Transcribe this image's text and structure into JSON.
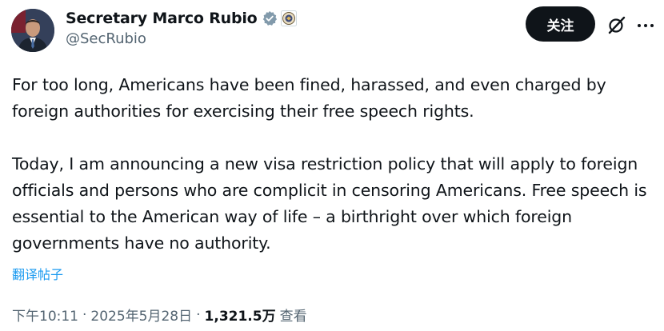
{
  "author": {
    "name": "Secretary Marco Rubio",
    "handle": "@SecRubio"
  },
  "follow_label": "关注",
  "tweet": {
    "paragraph1": "For too long, Americans have been fined, harassed, and even charged by foreign authorities for exercising their free speech rights.",
    "paragraph2": "Today, I am announcing a new visa restriction policy that will apply to foreign officials and persons who are complicit in censoring Americans. Free speech is essential to the American way of life – a birthright over which foreign governments have no authority."
  },
  "translate_label": "翻译帖子",
  "meta": {
    "time": "下午10:11",
    "separator": "·",
    "date": "2025年5月28日",
    "views_count": "1,321.5万",
    "views_label": "查看"
  },
  "icons": {
    "verified": "verified-badge-icon",
    "affiliation": "state-department-seal-icon",
    "grok": "grok-icon",
    "more": "more-options-icon"
  },
  "colors": {
    "verified_badge": "#829aab",
    "link": "#1d9bf0",
    "secondary_text": "#536471",
    "button_bg": "#0f1419"
  }
}
